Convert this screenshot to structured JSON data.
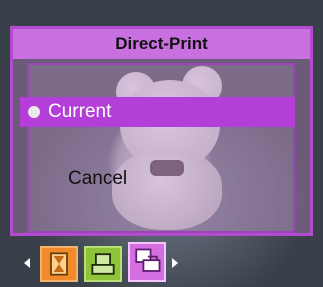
{
  "menu": {
    "title": "Direct-Print",
    "options": [
      {
        "label": "Current",
        "selected": true
      },
      {
        "label": "Cancel",
        "selected": false
      }
    ]
  },
  "bottom_bar": {
    "icons": [
      {
        "name": "hourglass-icon",
        "color": "#f08a2a"
      },
      {
        "name": "printer-icon",
        "color": "#8fc33a"
      },
      {
        "name": "direct-print-icon",
        "color": "#d36fe0",
        "selected": true
      }
    ]
  },
  "colors": {
    "accent": "#b43fd8",
    "title_bar": "#c870e0"
  }
}
